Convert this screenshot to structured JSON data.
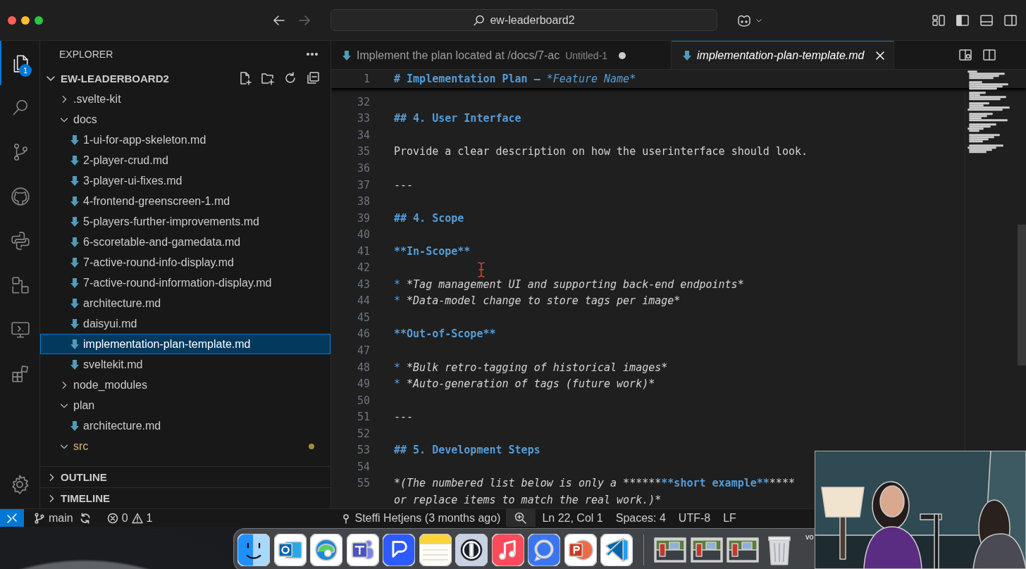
{
  "titlebar": {
    "search": "ew-leaderboard2"
  },
  "activity_bar": {
    "items": [
      {
        "kind": "explorer",
        "selected": true,
        "badge": "1"
      },
      {
        "kind": "search",
        "selected": false
      },
      {
        "kind": "source-control",
        "selected": false
      },
      {
        "kind": "github",
        "selected": false
      },
      {
        "kind": "python",
        "selected": false
      },
      {
        "kind": "nodes",
        "selected": false
      },
      {
        "kind": "remote",
        "selected": false
      },
      {
        "kind": "extensions",
        "selected": false
      }
    ]
  },
  "sidebar": {
    "title": "EXPLORER",
    "root": {
      "label": "EW-LEADERBOARD2",
      "expanded": true
    },
    "tree": [
      {
        "label": ".svelte-kit",
        "kind": "folder",
        "expanded": false,
        "selected": false,
        "modified": false
      },
      {
        "label": "docs",
        "kind": "folder",
        "expanded": true,
        "selected": false,
        "modified": false,
        "children": [
          {
            "label": "1-ui-for-app-skeleton.md",
            "kind": "markdown",
            "selected": false,
            "modified": false
          },
          {
            "label": "2-player-crud.md",
            "kind": "markdown",
            "selected": false,
            "modified": false
          },
          {
            "label": "3-player-ui-fixes.md",
            "kind": "markdown",
            "selected": false,
            "modified": false
          },
          {
            "label": "4-frontend-greenscreen-1.md",
            "kind": "markdown",
            "selected": false,
            "modified": false
          },
          {
            "label": "5-players-further-improvements.md",
            "kind": "markdown",
            "selected": false,
            "modified": false
          },
          {
            "label": "6-scoretable-and-gamedata.md",
            "kind": "markdown",
            "selected": false,
            "modified": false
          },
          {
            "label": "7-active-round-info-display.md",
            "kind": "markdown",
            "selected": false,
            "modified": false
          },
          {
            "label": "7-active-round-information-display.md",
            "kind": "markdown",
            "selected": false,
            "modified": false
          },
          {
            "label": "architecture.md",
            "kind": "markdown",
            "selected": false,
            "modified": false
          },
          {
            "label": "daisyui.md",
            "kind": "markdown",
            "selected": false,
            "modified": false
          },
          {
            "label": "implementation-plan-template.md",
            "kind": "markdown",
            "selected": true,
            "modified": false
          },
          {
            "label": "sveltekit.md",
            "kind": "markdown",
            "selected": false,
            "modified": false
          }
        ]
      },
      {
        "label": "node_modules",
        "kind": "folder",
        "expanded": false,
        "selected": false,
        "modified": false
      },
      {
        "label": "plan",
        "kind": "folder",
        "expanded": true,
        "selected": false,
        "modified": false,
        "children": [
          {
            "label": "architecture.md",
            "kind": "markdown",
            "selected": false,
            "modified": false
          }
        ]
      },
      {
        "label": "src",
        "kind": "folder",
        "expanded": true,
        "selected": false,
        "modified": true
      }
    ],
    "panels": [
      {
        "label": "OUTLINE",
        "expanded": false
      },
      {
        "label": "TIMELINE",
        "expanded": false
      }
    ]
  },
  "tabs": [
    {
      "label": "Implement the plan located at /docs/7-ac",
      "description": "Untitled-1",
      "dirty": true,
      "preview": false,
      "selected": false
    },
    {
      "label": "implementation-plan-template.md",
      "dirty": false,
      "preview": true,
      "selected": true
    }
  ],
  "editor": {
    "sticky": {
      "number": "1",
      "segments": [
        {
          "kind": "heading",
          "text": "# Implementation Plan – "
        },
        {
          "kind": "heading-italic",
          "text": "*Feature Name*"
        }
      ]
    },
    "lines": [
      {
        "number": "32"
      },
      {
        "number": "33",
        "segments": [
          {
            "kind": "heading",
            "text": "## 4. User Interface"
          }
        ]
      },
      {
        "number": "34"
      },
      {
        "number": "35",
        "segments": [
          {
            "kind": "text",
            "text": "Provide a clear description on how the userinterface should look."
          }
        ]
      },
      {
        "number": "36"
      },
      {
        "number": "37",
        "segments": [
          {
            "kind": "text",
            "text": "---"
          }
        ]
      },
      {
        "number": "38"
      },
      {
        "number": "39",
        "segments": [
          {
            "kind": "heading",
            "text": "## 4. Scope"
          }
        ]
      },
      {
        "number": "40"
      },
      {
        "number": "41",
        "segments": [
          {
            "kind": "strong",
            "text": "**In-Scope**"
          }
        ]
      },
      {
        "number": "42"
      },
      {
        "number": "43",
        "segments": [
          {
            "kind": "bullet",
            "text": "*"
          },
          {
            "kind": "italic",
            "text": "*Tag management UI and supporting back-end endpoints*"
          }
        ]
      },
      {
        "number": "44",
        "segments": [
          {
            "kind": "bullet",
            "text": "*"
          },
          {
            "kind": "italic",
            "text": "*Data-model change to store tags per image*"
          }
        ]
      },
      {
        "number": "45"
      },
      {
        "number": "46",
        "segments": [
          {
            "kind": "strong",
            "text": "**Out-of-Scope**"
          }
        ]
      },
      {
        "number": "47"
      },
      {
        "number": "48",
        "segments": [
          {
            "kind": "bullet",
            "text": "*"
          },
          {
            "kind": "italic",
            "text": "*Bulk retro-tagging of historical images*"
          }
        ]
      },
      {
        "number": "49",
        "segments": [
          {
            "kind": "bullet",
            "text": "*"
          },
          {
            "kind": "italic",
            "text": "*Auto-generation of tags (future work)*"
          }
        ]
      },
      {
        "number": "50"
      },
      {
        "number": "51",
        "segments": [
          {
            "kind": "text",
            "text": "---"
          }
        ]
      },
      {
        "number": "52"
      },
      {
        "number": "53",
        "segments": [
          {
            "kind": "heading",
            "text": "## 5. Development Steps"
          }
        ]
      },
      {
        "number": "54"
      },
      {
        "number": "55",
        "segments": [
          {
            "kind": "italic",
            "text": "*(The numbered list below is only a ******"
          },
          {
            "kind": "strong",
            "text": "**short example**"
          },
          {
            "kind": "italic",
            "text": "****"
          }
        ]
      },
      {
        "segments": [
          {
            "kind": "italic",
            "text": "or replace items to match the real work.)*"
          }
        ]
      }
    ]
  },
  "status_bar": {
    "branch": "main",
    "errors": "0",
    "warnings": "1",
    "blame": "Steffi Hetjens (3 months ago)",
    "items": [
      "Ln 22, Col 1",
      "Spaces: 4",
      "UTF-8",
      "LF"
    ]
  },
  "dock": {
    "apps": [
      {
        "kind": "finder"
      },
      {
        "kind": "outlook"
      },
      {
        "kind": "edge"
      },
      {
        "kind": "teams"
      },
      {
        "kind": "bubble"
      },
      {
        "kind": "notes"
      },
      {
        "kind": "password"
      },
      {
        "kind": "music"
      },
      {
        "kind": "signal"
      },
      {
        "kind": "powerpoint"
      },
      {
        "kind": "vscode"
      }
    ],
    "stack": [
      {
        "kind": "picture"
      },
      {
        "kind": "picture"
      },
      {
        "kind": "picture"
      },
      {
        "kind": "trash"
      }
    ]
  },
  "desktop": {
    "label": "vo"
  },
  "camera": {
    "kind": "picture"
  }
}
